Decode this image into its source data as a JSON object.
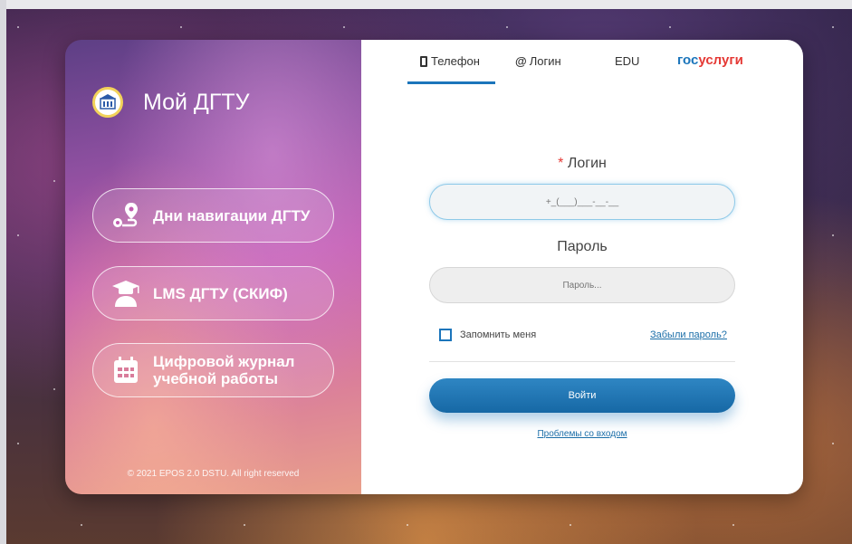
{
  "brand": {
    "title": "Мой ДГТУ",
    "copyright": "© 2021 EPOS 2.0 DSTU. All right reserved"
  },
  "nav_buttons": [
    {
      "label": "Дни навигации ДГТУ",
      "icon": "route-icon"
    },
    {
      "label": "LMS ДГТУ (СКИФ)",
      "icon": "student-icon"
    },
    {
      "label_line1": "Цифровой журнал",
      "label_line2": "учебной работы",
      "icon": "calendar-icon"
    }
  ],
  "tabs": {
    "phone": "Телефон",
    "login": "Логин",
    "edu": "EDU",
    "gos_part1": "гос",
    "gos_part2": "услуги"
  },
  "form": {
    "login_required_mark": "*",
    "login_label": "Логин",
    "login_placeholder": "+_(___)___-__-__",
    "password_label": "Пароль",
    "password_placeholder": "Пароль...",
    "remember_label": "Запомнить меня",
    "forgot_link": "Забыли пароль?",
    "submit_label": "Войти",
    "problems_link": "Проблемы со входом"
  },
  "colors": {
    "accent": "#1b75bb",
    "required": "#e53935",
    "gos_red": "#e53935"
  }
}
